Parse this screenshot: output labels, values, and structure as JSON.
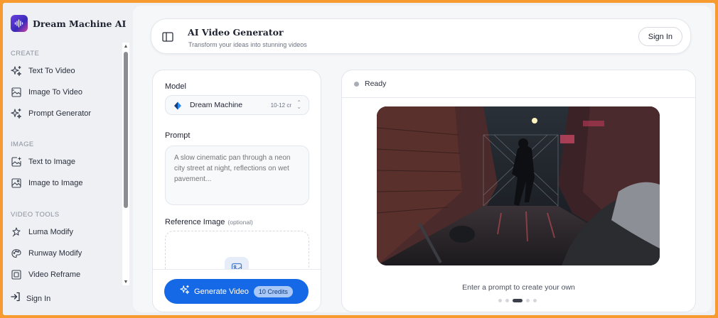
{
  "sidebar": {
    "brand": "Dream Machine AI",
    "sections": [
      {
        "title": "CREATE",
        "items": [
          {
            "label": "Text To Video",
            "icon": "sparkles-icon"
          },
          {
            "label": "Image To Video",
            "icon": "image-frame-icon"
          },
          {
            "label": "Prompt Generator",
            "icon": "sparkles-icon"
          }
        ]
      },
      {
        "title": "IMAGE",
        "items": [
          {
            "label": "Text to Image",
            "icon": "image-plus-icon"
          },
          {
            "label": "Image to Image",
            "icon": "image-icon"
          }
        ]
      },
      {
        "title": "VIDEO TOOLS",
        "items": [
          {
            "label": "Luma Modify",
            "icon": "wand-icon"
          },
          {
            "label": "Runway Modify",
            "icon": "palette-icon"
          },
          {
            "label": "Video Reframe",
            "icon": "reframe-icon"
          }
        ]
      }
    ],
    "sign_in": "Sign In"
  },
  "header": {
    "title": "AI Video Generator",
    "subtitle": "Transform your ideas into stunning videos",
    "sign_in": "Sign In"
  },
  "form": {
    "model_label": "Model",
    "model_name": "Dream Machine",
    "model_credits": "10-12 cr",
    "prompt_label": "Prompt",
    "prompt_placeholder": "A slow cinematic pan through a neon city street at night, reflections on wet pavement...",
    "reference_label": "Reference Image",
    "reference_optional": "(optional)",
    "generate_label": "Generate Video",
    "generate_credits": "10 Credits"
  },
  "preview": {
    "status": "Ready",
    "caption": "Enter a prompt to create your own",
    "carousel_count": 5,
    "carousel_active": 3
  },
  "colors": {
    "accent": "#1669e6",
    "page_border": "#f79a2f"
  }
}
